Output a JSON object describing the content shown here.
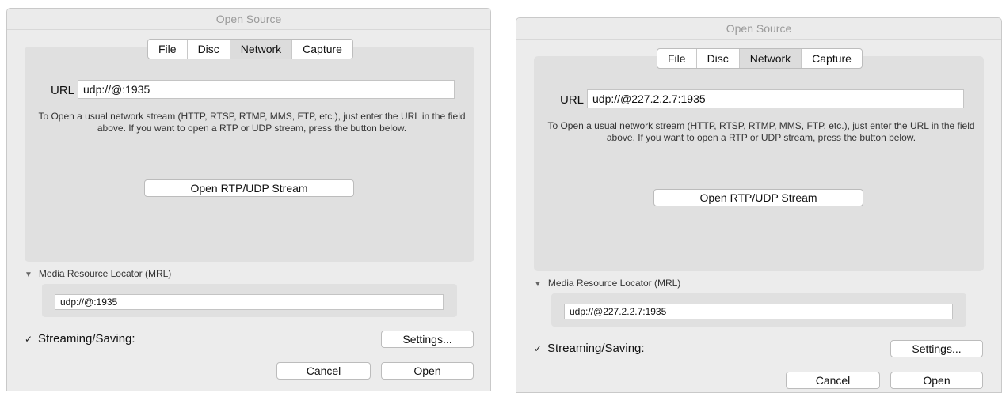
{
  "dialogs": [
    {
      "title": "Open Source",
      "tabs": [
        "File",
        "Disc",
        "Network",
        "Capture"
      ],
      "active_tab": "Network",
      "url_label": "URL",
      "url_value": "udp://@:1935",
      "help_text": "To Open a usual network stream (HTTP, RTSP, RTMP, MMS, FTP, etc.), just enter the URL in the field above. If you want to open a RTP or UDP stream, press the button below.",
      "rtp_button": "Open RTP/UDP Stream",
      "mrl_label": "Media Resource Locator (MRL)",
      "mrl_value": "udp://@:1935",
      "streaming_checked": true,
      "streaming_label": "Streaming/Saving:",
      "settings_button": "Settings...",
      "cancel_button": "Cancel",
      "open_button": "Open"
    },
    {
      "title": "Open Source",
      "tabs": [
        "File",
        "Disc",
        "Network",
        "Capture"
      ],
      "active_tab": "Network",
      "url_label": "URL",
      "url_value": "udp://@227.2.2.7:1935",
      "help_text": "To Open a usual network stream (HTTP, RTSP, RTMP, MMS, FTP, etc.), just enter the URL in the field above. If you want to open a RTP or UDP stream, press the button below.",
      "rtp_button": "Open RTP/UDP Stream",
      "mrl_label": "Media Resource Locator (MRL)",
      "mrl_value": "udp://@227.2.2.7:1935",
      "streaming_checked": true,
      "streaming_label": "Streaming/Saving:",
      "settings_button": "Settings...",
      "cancel_button": "Cancel",
      "open_button": "Open"
    }
  ]
}
